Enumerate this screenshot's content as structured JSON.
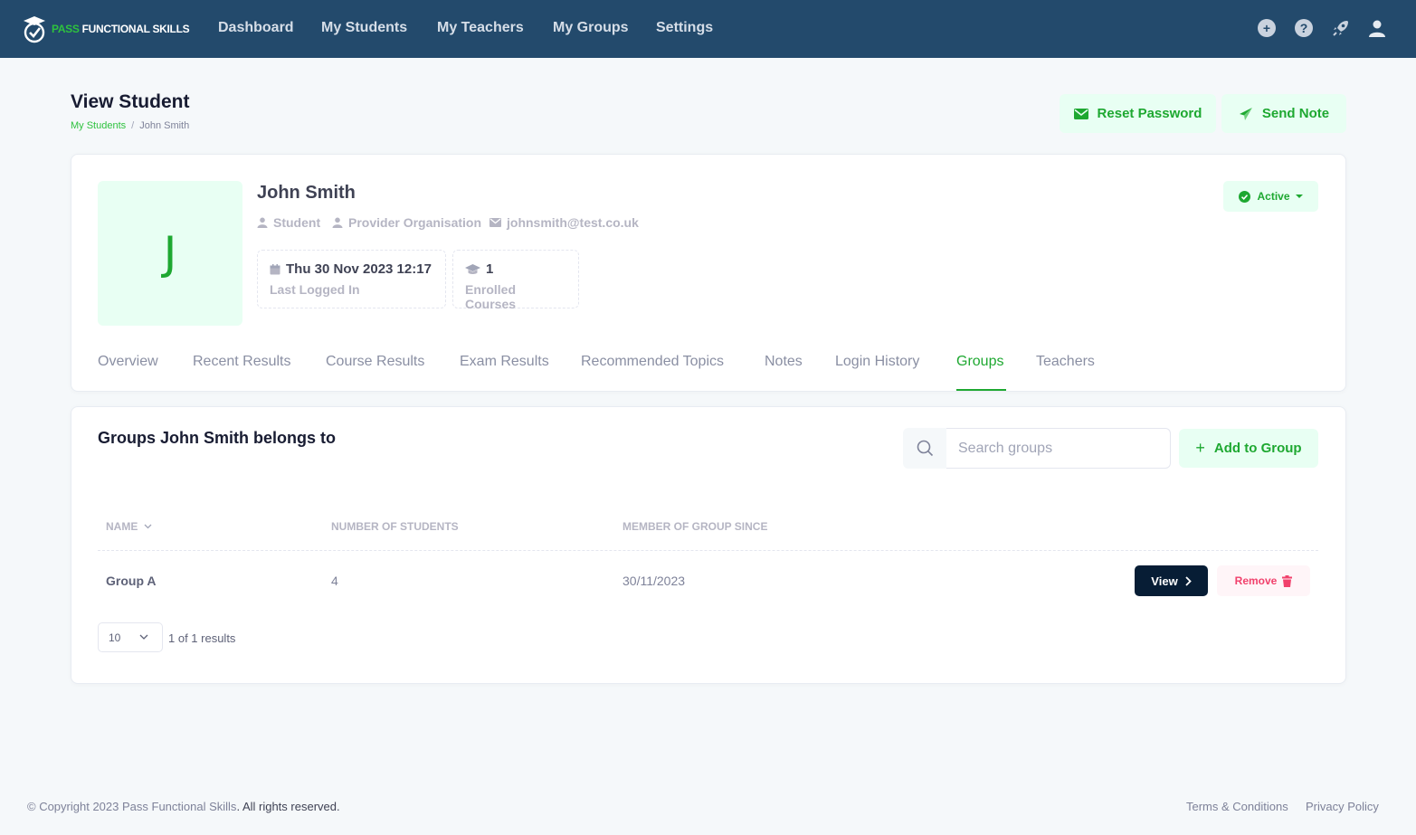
{
  "brand": {
    "pass": "PASS",
    "rest": "FUNCTIONAL SKILLS"
  },
  "nav": {
    "dashboard": "Dashboard",
    "my_students": "My Students",
    "my_teachers": "My Teachers",
    "my_groups": "My Groups",
    "settings": "Settings"
  },
  "header": {
    "title": "View Student",
    "breadcrumb_parent": "My Students",
    "breadcrumb_sep": "/",
    "breadcrumb_current": "John Smith",
    "reset_password": "Reset Password",
    "send_note": "Send Note"
  },
  "student": {
    "initial": "J",
    "name": "John Smith",
    "role": "Student",
    "organisation": "Provider Organisation",
    "email": "johnsmith@test.co.uk",
    "status": "Active",
    "last_login_value": "Thu 30 Nov 2023 12:17",
    "last_login_label": "Last Logged In",
    "enrolled_value": "1",
    "enrolled_label": "Enrolled Courses"
  },
  "tabs": {
    "overview": "Overview",
    "recent_results": "Recent Results",
    "course_results": "Course Results",
    "exam_results": "Exam Results",
    "recommended_topics": "Recommended Topics",
    "notes": "Notes",
    "login_history": "Login History",
    "groups": "Groups",
    "teachers": "Teachers"
  },
  "groups": {
    "title": "Groups John Smith belongs to",
    "search_placeholder": "Search groups",
    "add_button": "Add to Group",
    "columns": {
      "name": "Name",
      "students": "Number of Students",
      "since": "Member of Group Since"
    },
    "rows": [
      {
        "name": "Group A",
        "students": "4",
        "since": "30/11/2023",
        "view": "View",
        "remove": "Remove"
      }
    ],
    "page_size": "10",
    "results_text": "1 of 1 results"
  },
  "footer": {
    "copyright_prefix": "© Copyright 2023 ",
    "brand": "Pass Functional Skills",
    "rights": ". All rights reserved.",
    "terms": "Terms & Conditions",
    "privacy": "Privacy Policy"
  }
}
